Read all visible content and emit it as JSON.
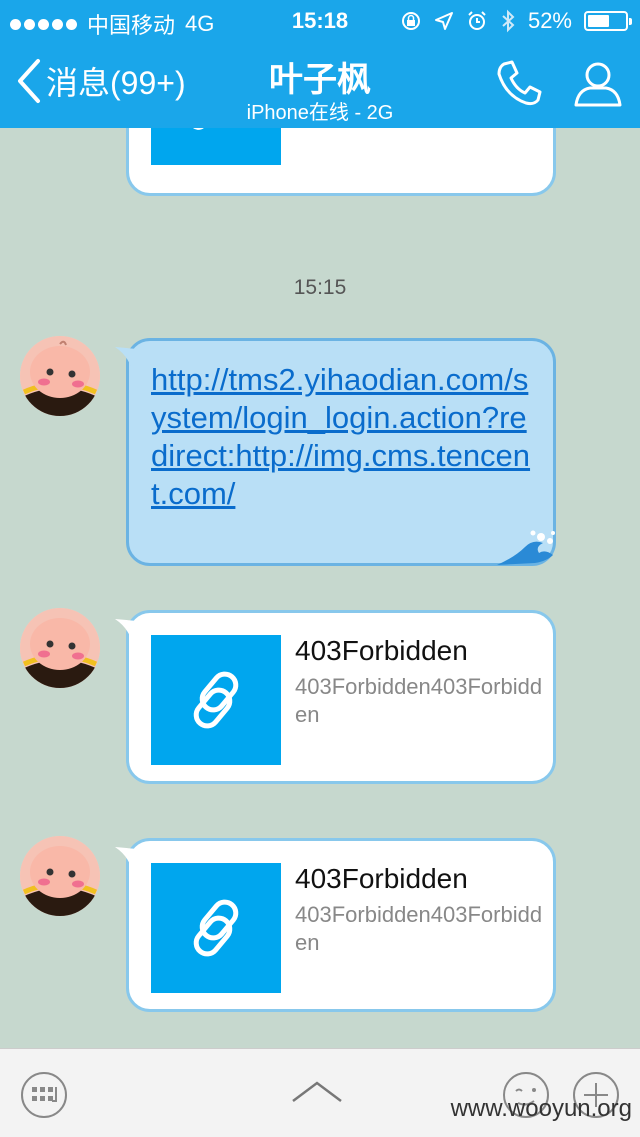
{
  "status_bar": {
    "carrier": "中国移动",
    "network": "4G",
    "time": "15:18",
    "battery_percent": "52%"
  },
  "nav": {
    "back_label": "消息(99+)",
    "title": "叶子枫",
    "subtitle": "iPhone在线 - 2G"
  },
  "chat": {
    "timestamp": "15:15",
    "link_message": "http://tms2.yihaodian.com/system/login_login.action?redirect:http://img.cms.tencent.com/",
    "cards": [
      {
        "title": "403Forbidden",
        "description": "403Forbidden403Forbidden"
      },
      {
        "title": "403Forbidden",
        "description": "403Forbidden403Forbidden"
      }
    ]
  },
  "watermark": "www.wooyun.org",
  "colors": {
    "header": "#1aa6ea",
    "chat_bg": "#c6d8ce",
    "link_tile": "#00a6ee",
    "bubble_blue": "#b9dff6"
  }
}
